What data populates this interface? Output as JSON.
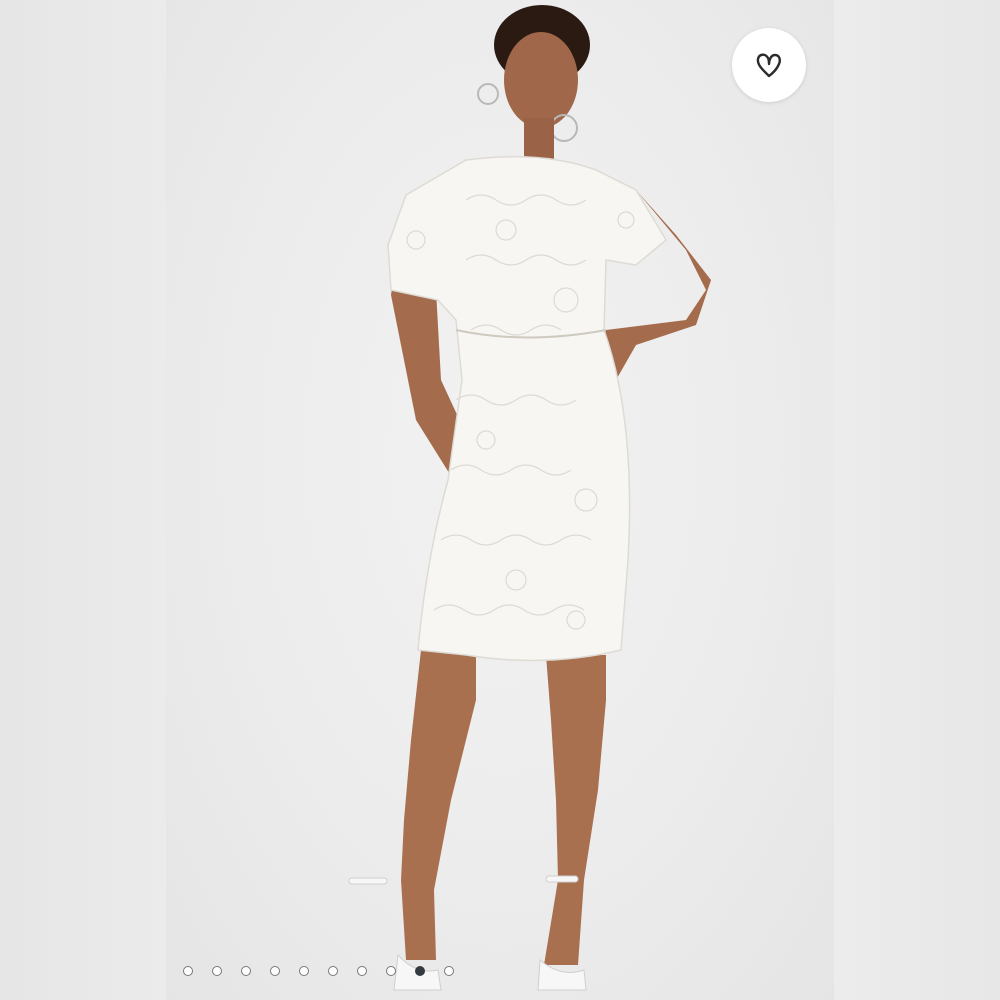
{
  "viewer": {
    "image_subject": "model-white-lace-dress"
  },
  "favorite": {
    "icon": "heart-outline-icon",
    "selected": false
  },
  "pager": {
    "total": 10,
    "active_index": 8
  },
  "colors": {
    "background": "#e9e9e9",
    "dot_active": "#333a40",
    "dot_inactive": "#ffffff"
  }
}
